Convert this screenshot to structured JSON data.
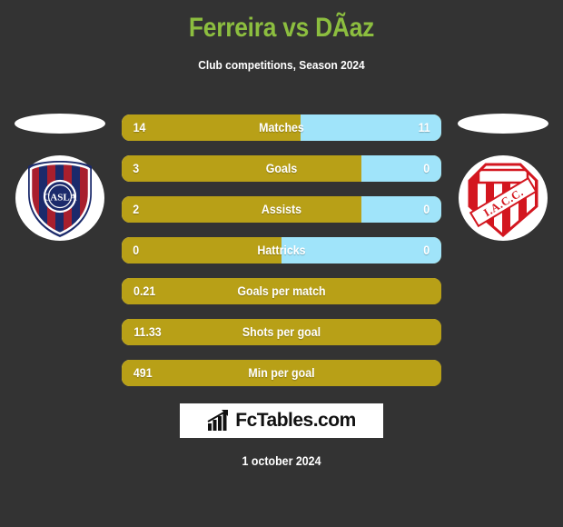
{
  "header": {
    "title": "Ferreira vs DÃaz",
    "subtitle": "Club competitions, Season 2024",
    "title_color": "#8CBE3F"
  },
  "colors": {
    "background": "#333333",
    "home_bar": "#B8A017",
    "away_bar": "#A0E4FA",
    "text": "#ffffff"
  },
  "home_team": {
    "crest_name": "san-lorenzo-crest",
    "crest_text": "CASLA"
  },
  "away_team": {
    "crest_name": "instituto-crest",
    "crest_text": "I.A.C.C."
  },
  "stats": [
    {
      "label": "Matches",
      "home": "14",
      "away": "11",
      "home_pct": 56,
      "split": true
    },
    {
      "label": "Goals",
      "home": "3",
      "away": "0",
      "home_pct": 75,
      "split": true
    },
    {
      "label": "Assists",
      "home": "2",
      "away": "0",
      "home_pct": 75,
      "split": true
    },
    {
      "label": "Hattricks",
      "home": "0",
      "away": "0",
      "home_pct": 50,
      "split": true
    },
    {
      "label": "Goals per match",
      "home": "0.21",
      "away": "",
      "home_pct": 100,
      "split": false
    },
    {
      "label": "Shots per goal",
      "home": "11.33",
      "away": "",
      "home_pct": 100,
      "split": false
    },
    {
      "label": "Min per goal",
      "home": "491",
      "away": "",
      "home_pct": 100,
      "split": false
    }
  ],
  "footer": {
    "brand_text": "FcTables.com",
    "brand_icon": "bar-chart-arrow-icon",
    "date": "1 october 2024"
  }
}
